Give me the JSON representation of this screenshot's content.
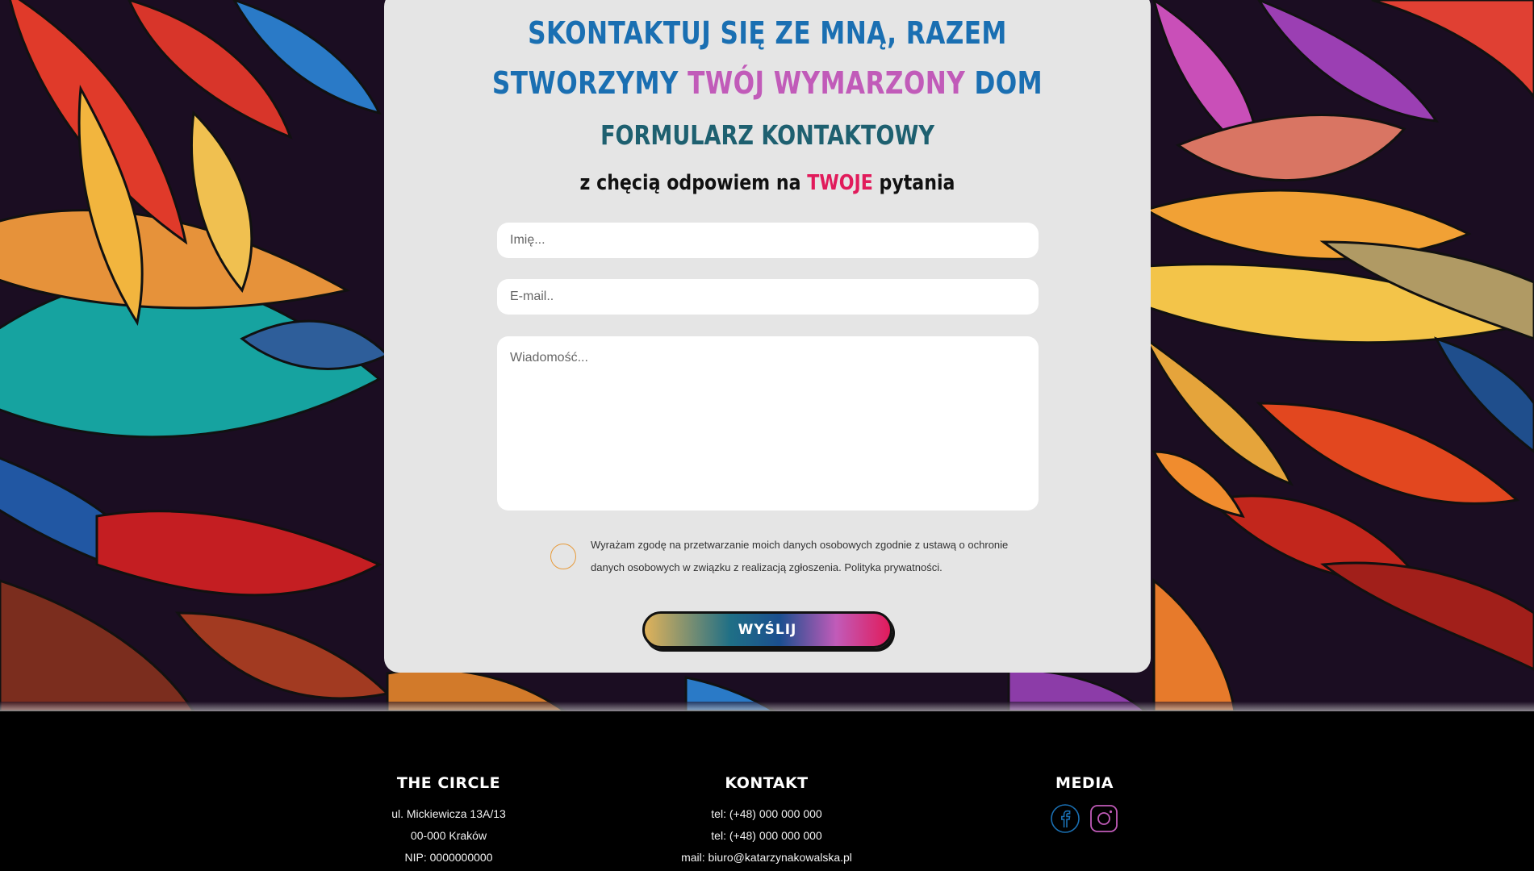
{
  "hero": {
    "headline_part1": "SKONTAKTUJ SIĘ ZE MNĄ, RAZEM",
    "headline_part2": "STWORZYMY ",
    "headline_accent": "TWÓJ WYMARZONY",
    "headline_part3": " DOM",
    "form_title": "FORMULARZ KONTAKTOWY",
    "tagline_before": "z chęcią odpowiem na ",
    "tagline_accent": "TWOJE",
    "tagline_after": " pytania"
  },
  "form": {
    "name_placeholder": "Imię...",
    "email_placeholder": "E-mail..",
    "message_placeholder": "Wiadomość...",
    "consent_text": "Wyrażam zgodę na przetwarzanie moich danych osobowych zgodnie z ustawą o ochronie danych osobowych w związku z realizacją zgłoszenia. Polityka prywatności.",
    "submit_label": "WYŚLIJ"
  },
  "footer": {
    "col1": {
      "title": "THE CIRCLE",
      "lines": [
        "ul. Mickiewicza 13A/13",
        "00-000 Kraków",
        "NIP: 0000000000"
      ]
    },
    "col2": {
      "title": "KONTAKT",
      "lines": [
        "tel: (+48) 000 000 000",
        "tel: (+48) 000 000 000",
        "mail: biuro@katarzynakowalska.pl"
      ]
    },
    "col3": {
      "title": "MEDIA",
      "icons": [
        "facebook-icon",
        "instagram-icon"
      ]
    }
  },
  "colors": {
    "primary_blue": "#1a6fb2",
    "accent_purple": "#c15bb9",
    "accent_pink": "#e11b5b",
    "teal": "#1e6070",
    "card_bg": "#e5e5e5"
  }
}
